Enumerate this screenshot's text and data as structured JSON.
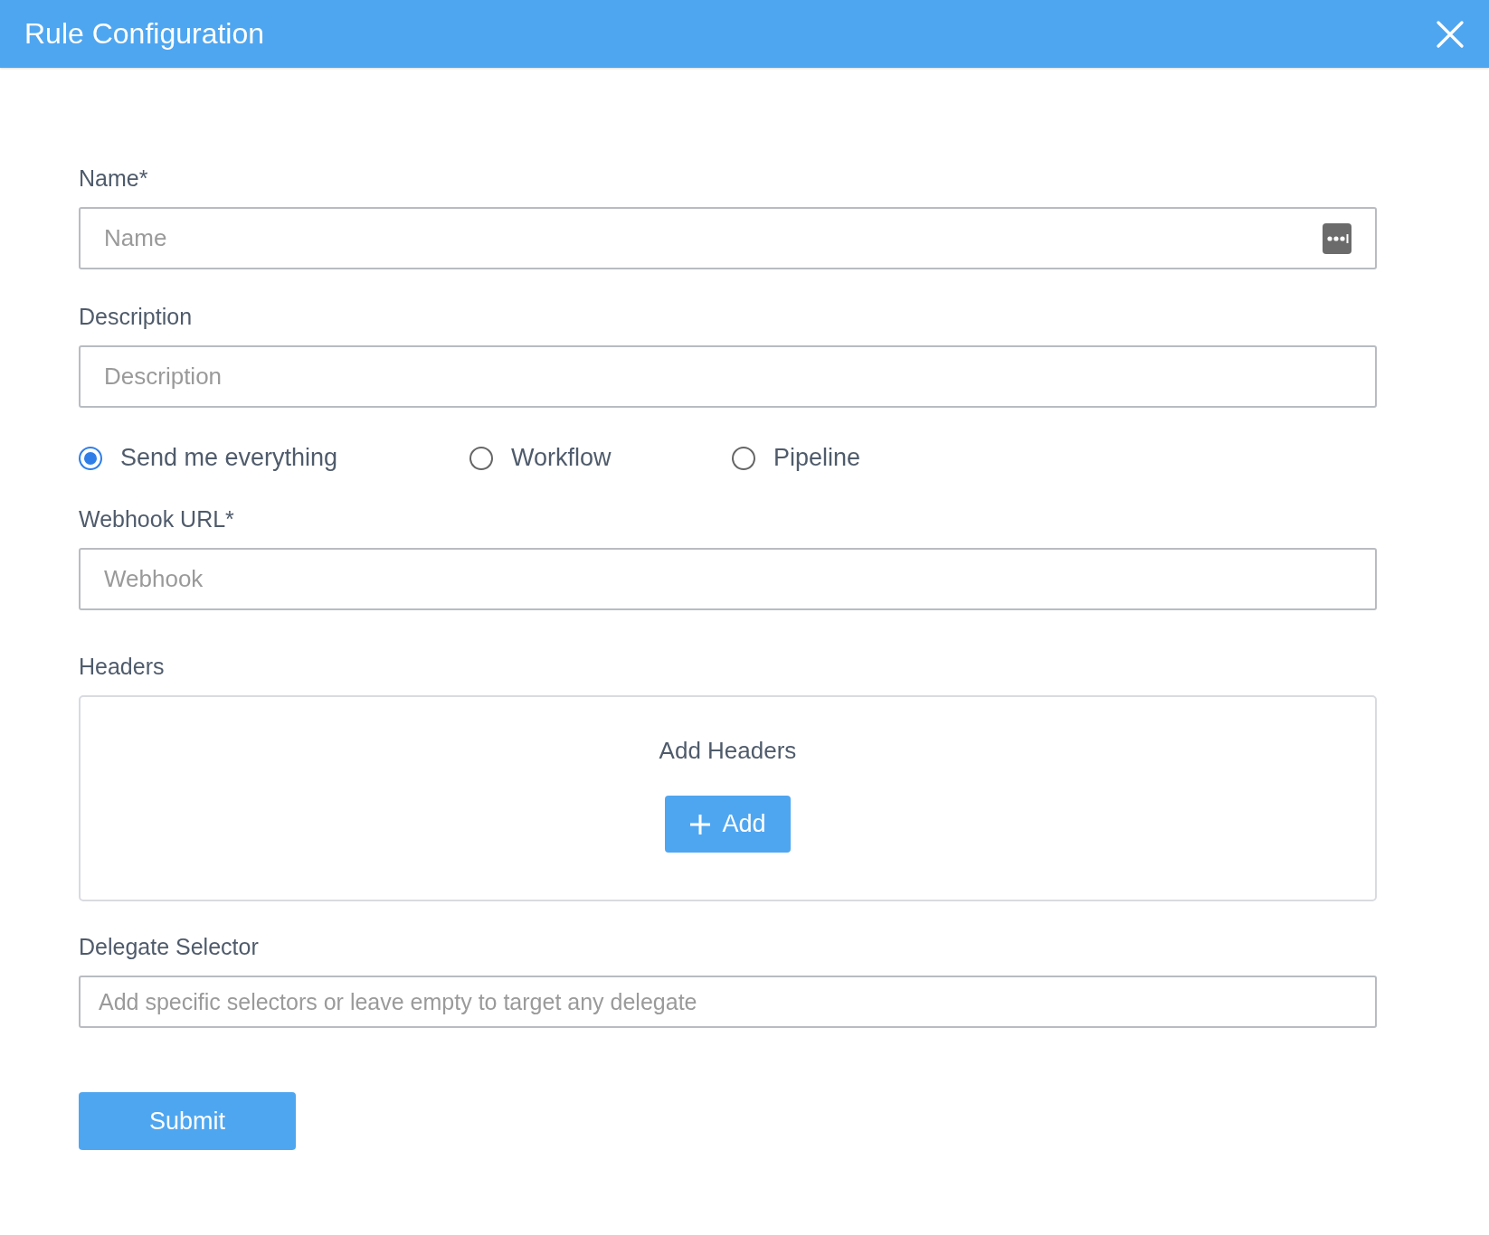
{
  "window": {
    "title": "Rule Configuration"
  },
  "fields": [
    {
      "label": "Name*",
      "placeholder": "Name",
      "has_icon": true
    },
    {
      "label": "Description",
      "placeholder": "Description",
      "has_icon": false
    }
  ],
  "radios": [
    {
      "label": "Send me everything",
      "selected": true
    },
    {
      "label": "Workflow",
      "selected": false
    },
    {
      "label": "Pipeline",
      "selected": false
    }
  ],
  "webhook": {
    "label": "Webhook URL*",
    "placeholder": "Webhook"
  },
  "headers": {
    "label": "Headers",
    "empty_text": "Add Headers",
    "add_button": "Add"
  },
  "delegate": {
    "label": "Delegate Selector",
    "placeholder": "Add specific selectors or leave empty to target any delegate"
  },
  "submit": "Submit"
}
